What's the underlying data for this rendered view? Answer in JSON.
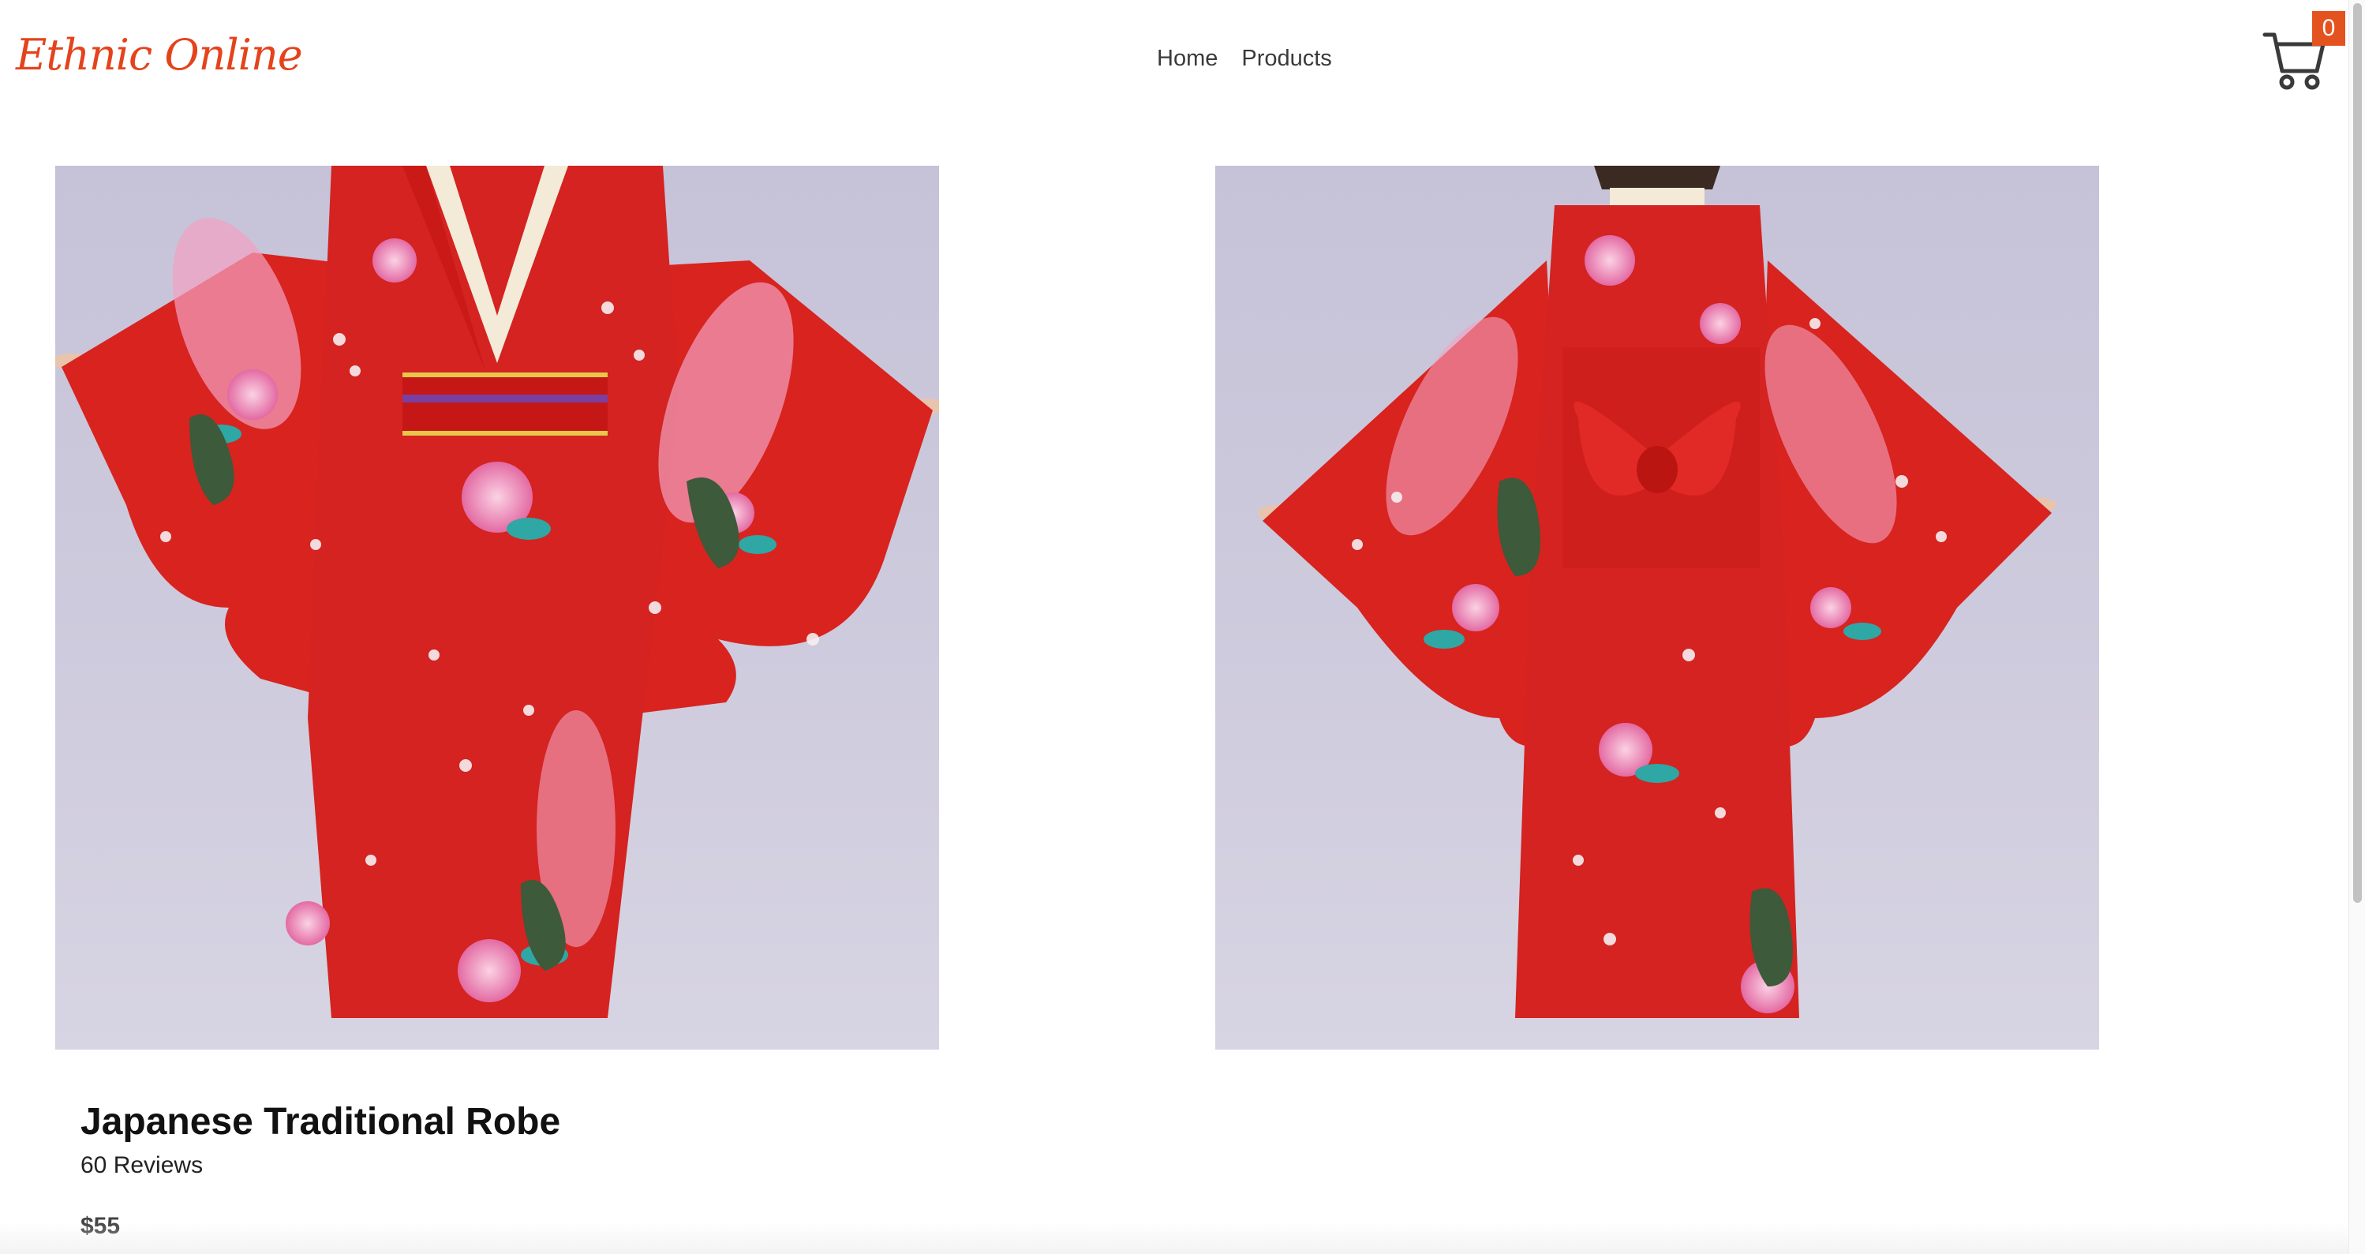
{
  "header": {
    "brand": "Ethnic Online",
    "nav": [
      {
        "label": "Home"
      },
      {
        "label": "Products"
      }
    ],
    "cart": {
      "icon": "cart-icon",
      "count": "0",
      "badge_color": "#e4521f"
    }
  },
  "gallery": {
    "images": [
      {
        "view": "front",
        "alt": "kimono-front-photo"
      },
      {
        "view": "back",
        "alt": "kimono-back-photo"
      }
    ]
  },
  "product": {
    "title": "Japanese Traditional Robe",
    "reviews": "60 Reviews",
    "price": "$55"
  },
  "colors": {
    "brand": "#e4431c",
    "kimono_red": "#d8231f",
    "backdrop": "#cac7db"
  }
}
